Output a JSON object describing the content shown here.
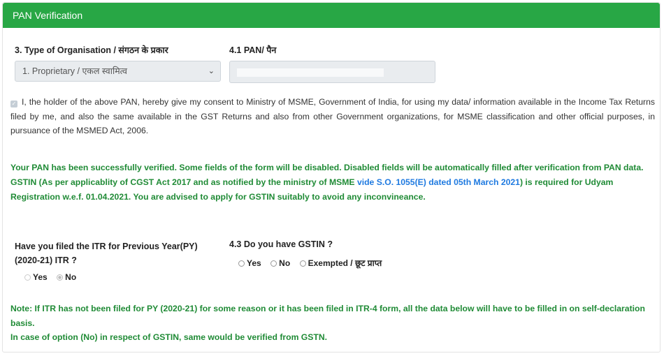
{
  "header": {
    "title": "PAN Verification"
  },
  "org_type": {
    "label": "3. Type of Organisation / संगठन के प्रकार",
    "selected": "1. Proprietary / एकल स्वामित्व"
  },
  "pan": {
    "label": "4.1 PAN/ पैन",
    "value": ""
  },
  "consent": {
    "checked": true,
    "text": "I, the holder of the above PAN, hereby give my consent to Ministry of MSME, Government of India, for using my data/ information available in the Income Tax Returns filed by me, and also the same available in the GST Returns and also from other Government organizations, for MSME classification and other official purposes, in pursuance of the MSMED Act, 2006."
  },
  "verification_message": {
    "line1": "Your PAN has been successfully verified. Some fields of the form will be disabled. Disabled fields will be automatically filled after verification from PAN data.",
    "gstin_prefix": "GSTIN (As per applicablity of CGST Act 2017 and as notified by the ministry of MSME ",
    "gstin_link": "vide S.O. 1055(E) dated 05th March 2021",
    "gstin_suffix": ") is required for Udyam Registration w.e.f. 01.04.2021. You are advised to apply for GSTIN suitably to avoid any inconvineance."
  },
  "itr": {
    "label_line1": "Have you filed the ITR for Previous Year(PY)",
    "label_line2": "(2020-21) ITR ?",
    "options": [
      "Yes",
      "No"
    ],
    "selected": "No"
  },
  "gstin": {
    "label": "4.3 Do you have GSTIN ?",
    "options": [
      "Yes",
      "No",
      "Exempted / छूट प्राप्त"
    ],
    "selected": null
  },
  "note": {
    "line1": "Note: If ITR has not been filed for PY (2020-21) for some reason or it has been filed in ITR-4 form, all the data below will have to be filled in on self-declaration basis.",
    "line2": "In case of option (No) in respect of GSTIN, same would be verified from GSTN."
  },
  "colors": {
    "header_bg": "#28a745",
    "success_text": "#208b36",
    "link": "#1f7ae0"
  }
}
